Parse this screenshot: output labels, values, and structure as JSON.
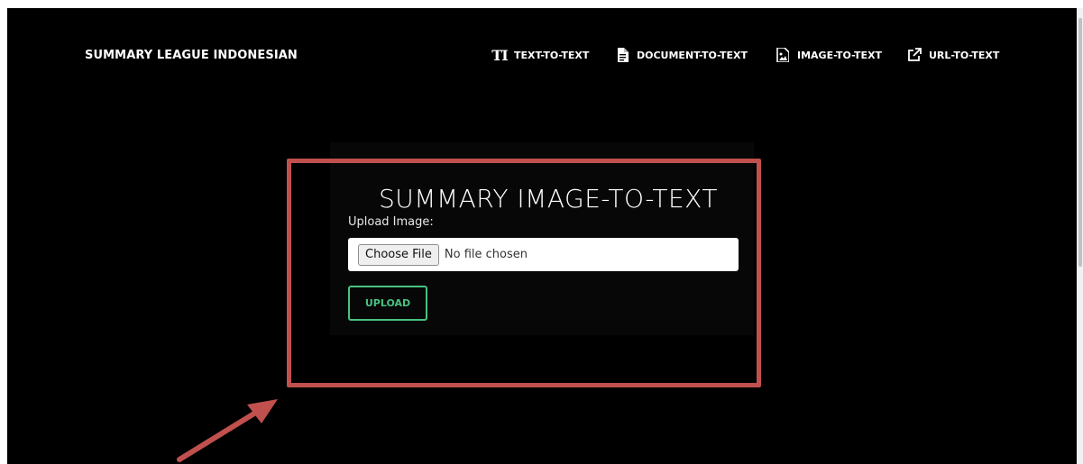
{
  "brand": "SUMMARY LEAGUE INDONESIAN",
  "nav": [
    {
      "label": "TEXT-TO-TEXT",
      "icon": "text-format-icon"
    },
    {
      "label": "DOCUMENT-TO-TEXT",
      "icon": "document-icon"
    },
    {
      "label": "IMAGE-TO-TEXT",
      "icon": "image-icon"
    },
    {
      "label": "URL-TO-TEXT",
      "icon": "external-link-icon"
    }
  ],
  "main": {
    "title": "SUMMARY IMAGE-TO-TEXT",
    "upload_label": "Upload Image:",
    "file_input": {
      "button_label": "Choose File",
      "status": "No file chosen"
    },
    "upload_button": "UPLOAD"
  },
  "annotation": {
    "color": "#c0504d"
  },
  "colors": {
    "background": "#000000",
    "accent": "#49c281",
    "text": "#ffffff"
  }
}
